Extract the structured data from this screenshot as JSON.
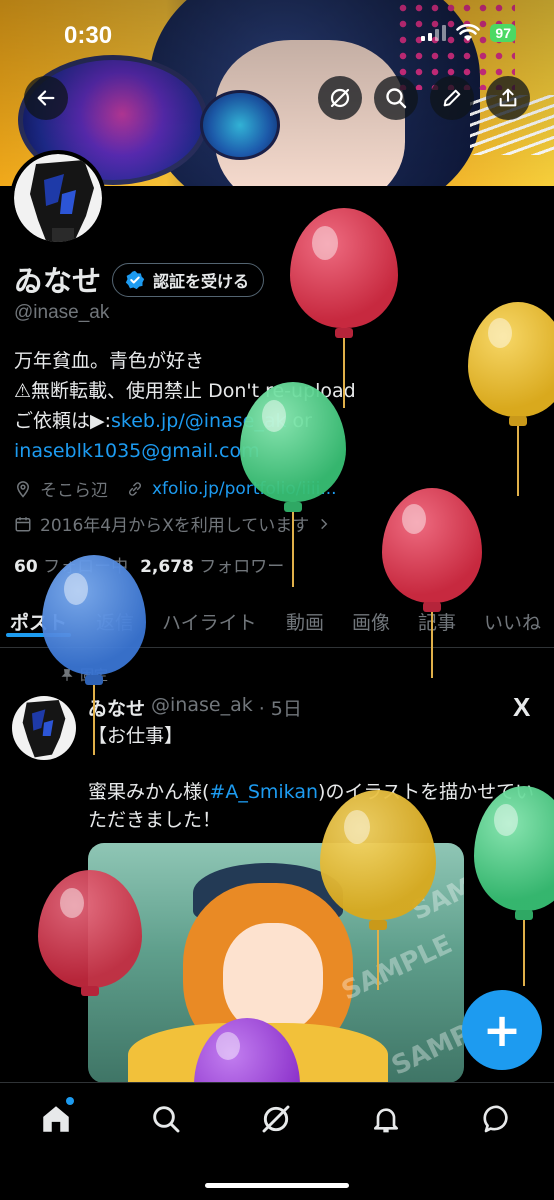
{
  "status_bar": {
    "time": "0:30",
    "battery": "97"
  },
  "profile": {
    "display_name": "ゐなせ",
    "verify_button": "認証を受ける",
    "handle": "@inase_ak",
    "bio_line1": "万年貧血。青色が好き",
    "bio_line2": "⚠無断転載、使用禁止 Don't re-upload",
    "bio_line3_prefix": "ご依頼は▶:",
    "bio_link_skeb": "skeb.jp/@inase_ak",
    "bio_or": " or",
    "bio_email": "inaseblk1035@gmail.com",
    "location": "そこら辺",
    "website": "xfolio.jp/portfolio/iiii...",
    "joined": "2016年4月からXを利用しています",
    "following_count": "60",
    "following_label": "フォロー中",
    "followers_count": "2,678",
    "followers_label": "フォロワー"
  },
  "tabs": [
    "ポスト",
    "返信",
    "ハイライト",
    "動画",
    "画像",
    "記事",
    "いいね"
  ],
  "post": {
    "pinned_label": "固定",
    "author": "ゐなせ",
    "handle": "@inase_ak",
    "time": "· 5日",
    "platform_mark": "X",
    "text_line1": "【お仕事】",
    "text_line2_a": "蜜果みかん様(",
    "text_line2_link": "#A_Smikan",
    "text_line2_b": ")のイラストを描かせていただきました！",
    "image_watermark": "SAMPLE"
  },
  "fab_label": "+",
  "icons": {
    "back": "back-arrow-icon",
    "grok": "grok-icon",
    "search": "search-icon",
    "edit": "edit-icon",
    "share": "share-icon",
    "verified": "verified-badge-icon",
    "location": "location-icon",
    "link": "link-icon",
    "calendar": "calendar-icon",
    "pin": "pin-icon",
    "home": "home-icon",
    "notifications": "bell-icon",
    "messages": "message-icon"
  },
  "colors": {
    "accent": "#1d9bf0",
    "balloon_red": "#d63a52",
    "balloon_yellow": "#e8b92a",
    "balloon_green": "#4dd389",
    "balloon_blue": "#3f7fd8",
    "balloon_purple": "#9a3ed6"
  }
}
